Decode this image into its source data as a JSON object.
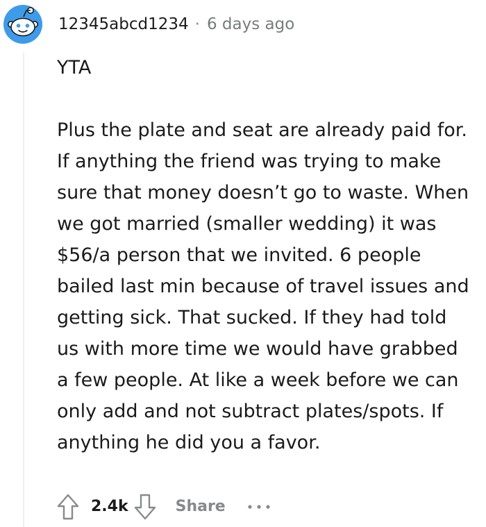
{
  "comment": {
    "username": "12345abcd1234",
    "separator": "·",
    "timestamp": "6 days ago",
    "paragraphs": [
      "YTA",
      "Plus the plate and seat are already paid for. If anything the friend was trying to make sure that money doesn’t go to waste. When we got married (smaller wedding) it was $56/a person that we invited. 6 people bailed last min because of travel issues and getting sick. That sucked. If they had told us with more time we would have grabbed a few people. At like a week before we can only add and not subtract plates/spots. If anything he did you a favor."
    ]
  },
  "actions": {
    "score": "2.4k",
    "share_label": "Share",
    "upvote_icon": "upvote-arrow-icon",
    "downvote_icon": "downvote-arrow-icon",
    "more_icon": "more-options-icon"
  },
  "colors": {
    "avatar_blue": "#3d9be9",
    "text": "#1a1a1b",
    "muted": "#878a8c",
    "thread_line": "#edeff1"
  }
}
